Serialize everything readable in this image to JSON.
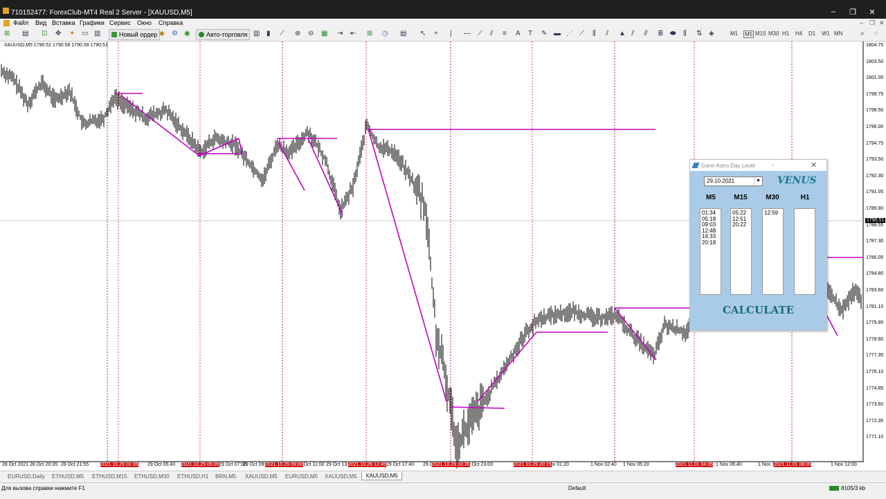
{
  "window": {
    "title": "710152477: ForexClub-MT4 Real 2 Server - [XAUUSD,M5]"
  },
  "menu": [
    "Файл",
    "Вид",
    "Вставка",
    "Графики",
    "Сервис",
    "Окно",
    "Справка"
  ],
  "toolbar": {
    "new_order": "Новый ордер",
    "auto_trading": "Авто-торговля",
    "timeframes": [
      "M1",
      "M5",
      "M15",
      "M30",
      "H1",
      "H4",
      "D1",
      "W1",
      "MN"
    ]
  },
  "chart": {
    "symbol_info": "XAUUSD,M5  1790.52 1790.58 1790.39 1790.51",
    "current_price": "1790.51",
    "price_labels": [
      "1804.75",
      "1803.50",
      "1801.00",
      "1799.75",
      "1798.50",
      "1796.00",
      "1794.75",
      "1793.50",
      "1792.30",
      "1791.05",
      "1789.80",
      "1788.55",
      "1787.30",
      "1786.05",
      "1784.80",
      "1783.60",
      "1781.10",
      "1779.85",
      "1778.60",
      "1777.35",
      "1776.10",
      "1774.85",
      "1773.60",
      "1772.35",
      "1771.10"
    ],
    "time_labels": [
      "28 Oct 2021",
      "28 Oct 20:35",
      "28 Oct 21:55",
      "29 Oct 03:00",
      "29 Oct 05:40",
      "29 Oct 07:00",
      "29 Oct 09:40",
      "29 Oct 11:00",
      "29 Oct 13:40",
      "29 Oct 17:40",
      "29 Oct 21:40",
      "29 Oct 23:00",
      "1 Nov 01:20",
      "1 Nov 02:40",
      "1 Nov 05:20",
      "1 Nov 06:40",
      "1 Nov 10:40",
      "1 Nov 12:00"
    ],
    "marker_labels": [
      "2021.10.29 01:35",
      "2021.10.29 05:05",
      "2021.10.29 09:00",
      "2021.10.29 12:45",
      "2021.10.29 16:35",
      "2021.10.29 20:15",
      "2021.11.01 04:35",
      "2021.11.01 08:05"
    ]
  },
  "panel": {
    "title": "Gann Astro Day Level",
    "date": "29.10.2021",
    "planet": "VENUS",
    "columns": [
      {
        "head": "M5",
        "times": [
          "01:34",
          "05:18",
          "09:03",
          "12:48",
          "16:33",
          "20:18"
        ]
      },
      {
        "head": "M15",
        "times": [
          "05:22",
          "12:51",
          "20:22"
        ]
      },
      {
        "head": "M30",
        "times": [
          "12:59"
        ]
      },
      {
        "head": "H1",
        "times": []
      }
    ],
    "calculate": "CALCULATE"
  },
  "tabs": [
    "EURUSD,Daily",
    "ETHUSD,M5",
    "ETHUSD,M15",
    "ETHUSD,M30",
    "ETHUSD,H1",
    "BRN,M5",
    "XAUUSD,M5",
    "EURUSD,M5",
    "XAUUSD,M5",
    "XAUUSD,M5"
  ],
  "status": {
    "help": "Для вызова справки нажмите F1",
    "profile": "Default",
    "traffic": "8105/3 kb"
  },
  "colors": {
    "accent_line": "#c000c0",
    "panel_bg": "#a9cbe8",
    "marker_red": "#d01010"
  }
}
